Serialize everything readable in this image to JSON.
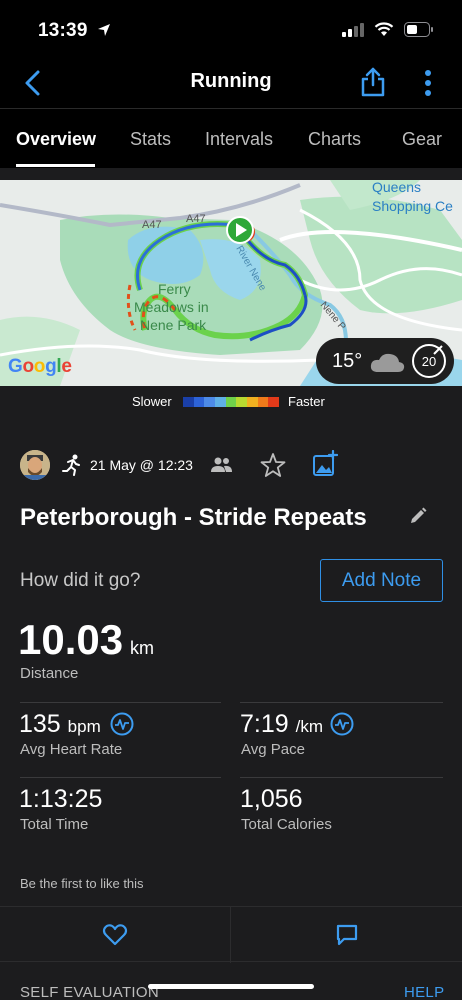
{
  "status_bar": {
    "time": "13:39"
  },
  "nav": {
    "title": "Running"
  },
  "tabs": [
    {
      "label": "Overview",
      "active": true
    },
    {
      "label": "Stats"
    },
    {
      "label": "Intervals"
    },
    {
      "label": "Charts"
    },
    {
      "label": "Gear"
    }
  ],
  "map": {
    "labels": {
      "queens_line1": "Queens",
      "queens_line2": "Shopping Ce",
      "ferry_line1": "Ferry",
      "ferry_line2": "Meadows in",
      "ferry_line3": "Nene Park",
      "road1": "A47",
      "road2": "A47",
      "river": "River Nene",
      "nene": "Nene P"
    },
    "google_logo": "Google",
    "weather": {
      "temperature": "15°",
      "wind_speed": "20"
    }
  },
  "pace_legend": {
    "slower_label": "Slower",
    "faster_label": "Faster",
    "colors": [
      "#1a3fa8",
      "#2d63d8",
      "#4d8be8",
      "#5fb0e6",
      "#6fd14a",
      "#b8d930",
      "#f0b020",
      "#f07a1a",
      "#e23a1a"
    ]
  },
  "activity": {
    "date": "21 May @ 12:23",
    "title": "Peterborough - Stride Repeats",
    "prompt": "How did it go?",
    "add_note_label": "Add Note",
    "distance_value": "10.03",
    "distance_unit": "km",
    "distance_label": "Distance"
  },
  "stats": {
    "avg_hr_value": "135",
    "avg_hr_unit": "bpm",
    "avg_hr_label": "Avg Heart Rate",
    "avg_pace_value": "7:19",
    "avg_pace_unit": "/km",
    "avg_pace_label": "Avg Pace",
    "total_time_value": "1:13:25",
    "total_time_label": "Total Time",
    "total_calories_value": "1,056",
    "total_calories_label": "Total Calories"
  },
  "social": {
    "like_prompt": "Be the first to like this"
  },
  "footer": {
    "self_evaluation_label": "SELF EVALUATION",
    "help_label": "HELP"
  },
  "colors": {
    "accent": "#3d9cf0",
    "background": "#1c1c1e"
  }
}
